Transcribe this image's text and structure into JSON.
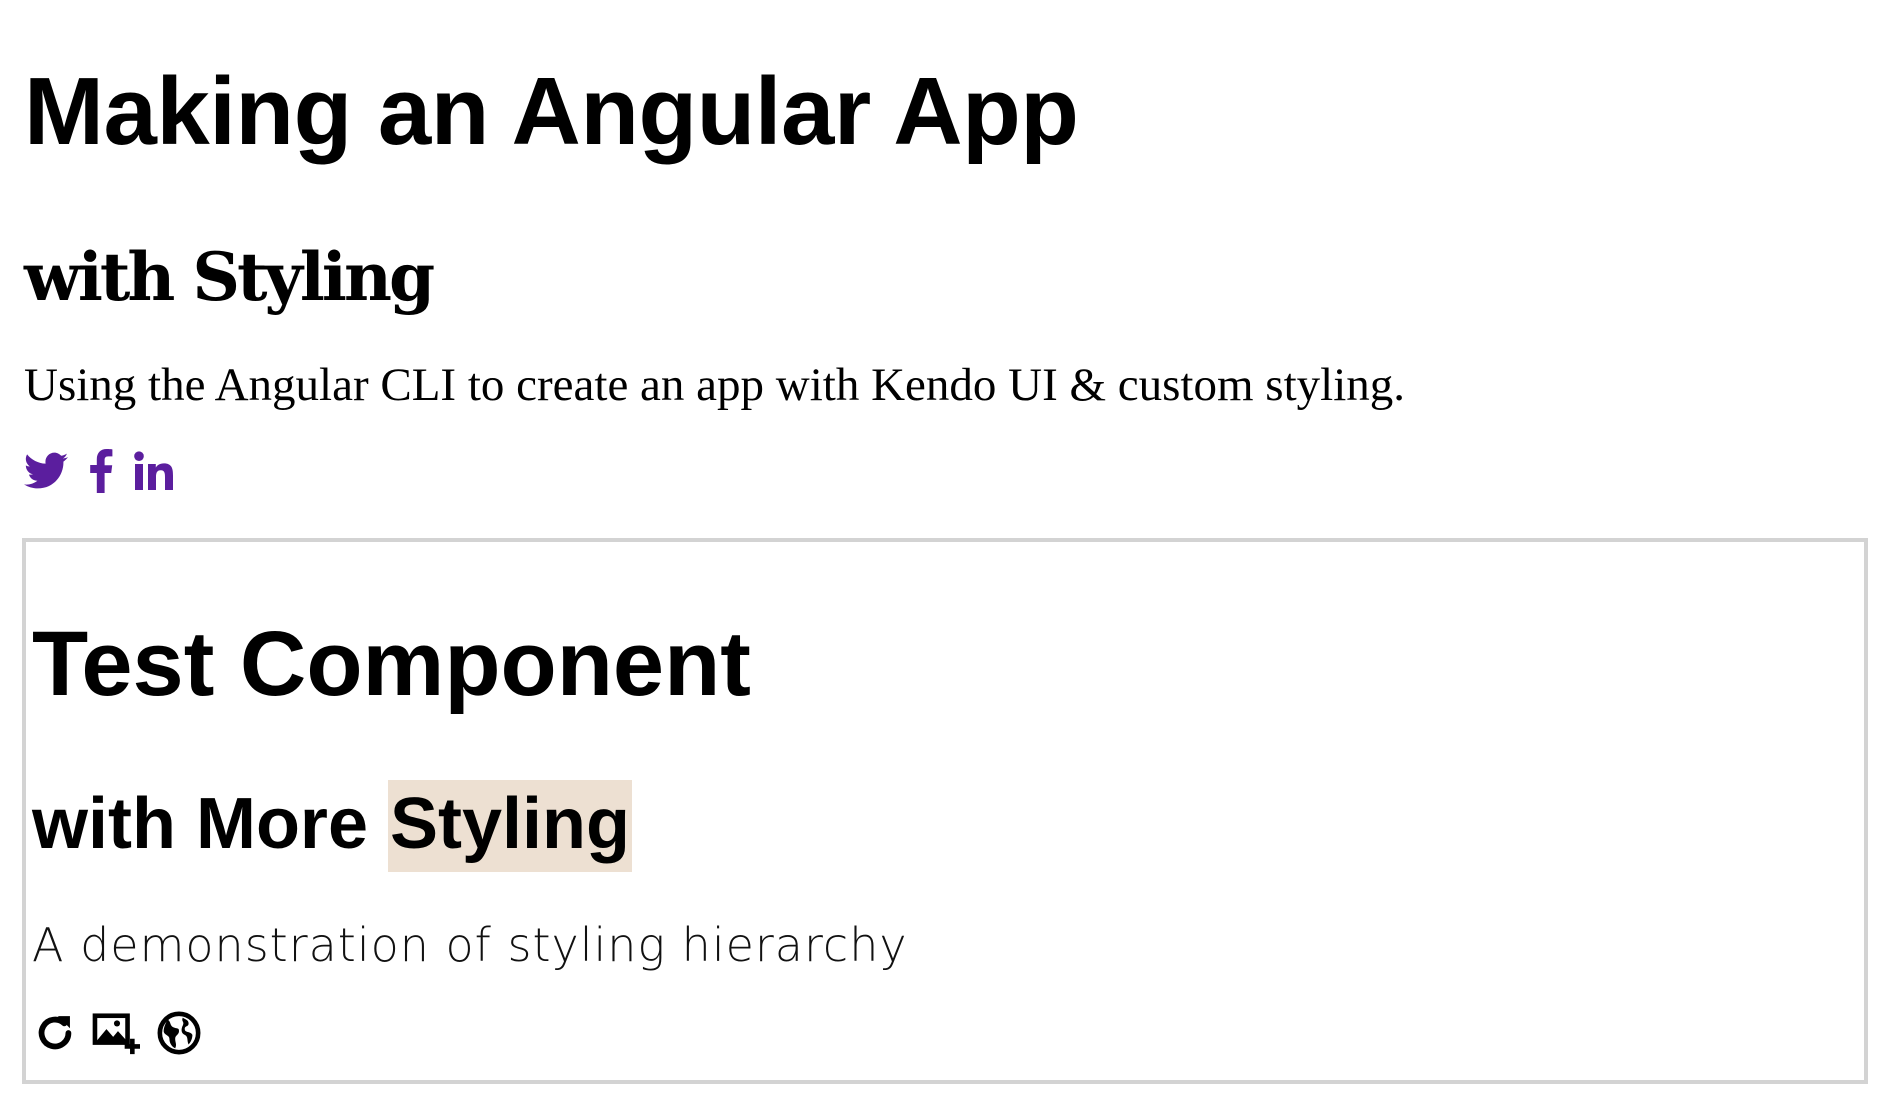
{
  "header": {
    "title": "Making an Angular App",
    "subtitle": "with Styling",
    "description": "Using the Angular CLI to create an app with Kendo UI & custom styling."
  },
  "social": {
    "icons": [
      "twitter-icon",
      "facebook-icon",
      "linkedin-icon"
    ],
    "color": "#5b1e9e"
  },
  "component": {
    "title": "Test Component",
    "subtitle_prefix": "with More ",
    "subtitle_highlight": "Styling",
    "highlight_color": "#ede0d2",
    "border_color": "#d3d3d3",
    "description": "A demonstration of styling hierarchy",
    "icons": [
      "reload-icon",
      "add-image-icon",
      "globe-icon"
    ]
  }
}
